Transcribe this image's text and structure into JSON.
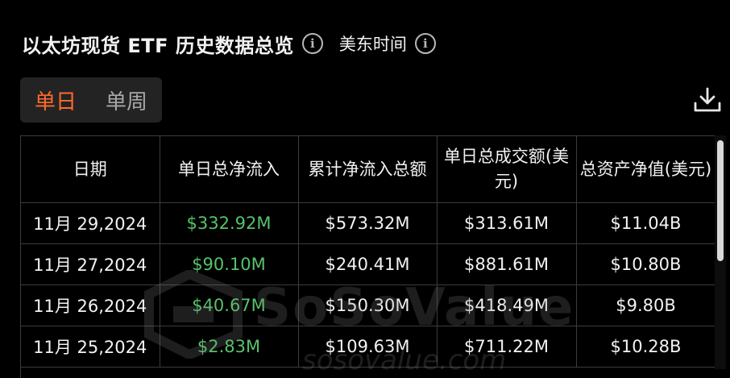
{
  "header": {
    "title": "以太坊现货 ETF 历史数据总览",
    "title_info_icon": "info-icon",
    "timezone_label": "美东时间",
    "timezone_info_icon": "info-icon"
  },
  "tabs": [
    {
      "label": "单日",
      "active": true
    },
    {
      "label": "单周",
      "active": false
    }
  ],
  "download_icon": "download-icon",
  "table": {
    "columns": [
      "日期",
      "单日总净流入",
      "累计净流入总额",
      "单日总成交额(美元)",
      "总资产净值(美元)"
    ],
    "rows": [
      {
        "date": "11月 29,2024",
        "daily_net_inflow": "$332.92M",
        "cumulative_net_inflow": "$573.32M",
        "daily_value_traded": "$313.61M",
        "total_net_assets": "$11.04B"
      },
      {
        "date": "11月 27,2024",
        "daily_net_inflow": "$90.10M",
        "cumulative_net_inflow": "$240.41M",
        "daily_value_traded": "$881.61M",
        "total_net_assets": "$10.80B"
      },
      {
        "date": "11月 26,2024",
        "daily_net_inflow": "$40.67M",
        "cumulative_net_inflow": "$150.30M",
        "daily_value_traded": "$418.49M",
        "total_net_assets": "$9.80B"
      },
      {
        "date": "11月 25,2024",
        "daily_net_inflow": "$2.83M",
        "cumulative_net_inflow": "$109.63M",
        "daily_value_traded": "$711.22M",
        "total_net_assets": "$10.28B"
      }
    ]
  },
  "watermark": {
    "brand": "SoSoValue",
    "url": "sosovalue.com"
  },
  "colors": {
    "accent": "#ff6a2b",
    "positive": "#56c26a",
    "background": "#000000"
  }
}
